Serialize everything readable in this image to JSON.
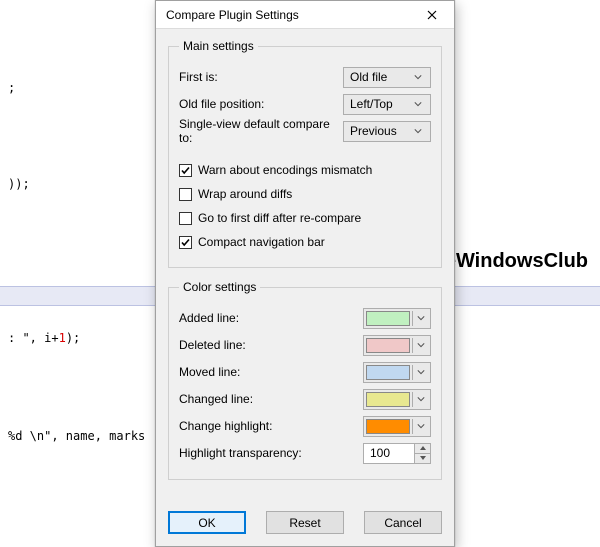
{
  "background_code": {
    "line1": ";",
    "line2": "));",
    "line3_prefix": ": \", i+",
    "line3_num": "1",
    "line3_suffix": ");",
    "line4_prefix": "%d \\n\", name, marks",
    "line4_suffix": ""
  },
  "watermark": "TheWindowsClub",
  "dialog": {
    "title": "Compare Plugin Settings",
    "main_group": {
      "legend": "Main settings",
      "first_is_label": "First is:",
      "first_is_value": "Old file",
      "old_pos_label": "Old file position:",
      "old_pos_value": "Left/Top",
      "single_view_label": "Single-view default compare to:",
      "single_view_value": "Previous",
      "cb_warn_label": "Warn about encodings mismatch",
      "cb_warn_checked": true,
      "cb_wrap_label": "Wrap around diffs",
      "cb_wrap_checked": false,
      "cb_goto_label": "Go to first diff after re-compare",
      "cb_goto_checked": false,
      "cb_compact_label": "Compact navigation bar",
      "cb_compact_checked": true
    },
    "color_group": {
      "legend": "Color settings",
      "added_label": "Added line:",
      "added_color": "#c0f0c0",
      "deleted_label": "Deleted line:",
      "deleted_color": "#f0c8c8",
      "moved_label": "Moved line:",
      "moved_color": "#c0d8f0",
      "changed_label": "Changed line:",
      "changed_color": "#e8e890",
      "highlight_label": "Change highlight:",
      "highlight_color": "#ff8c00",
      "transparency_label": "Highlight transparency:",
      "transparency_value": "100"
    },
    "buttons": {
      "ok": "OK",
      "reset": "Reset",
      "cancel": "Cancel"
    }
  }
}
